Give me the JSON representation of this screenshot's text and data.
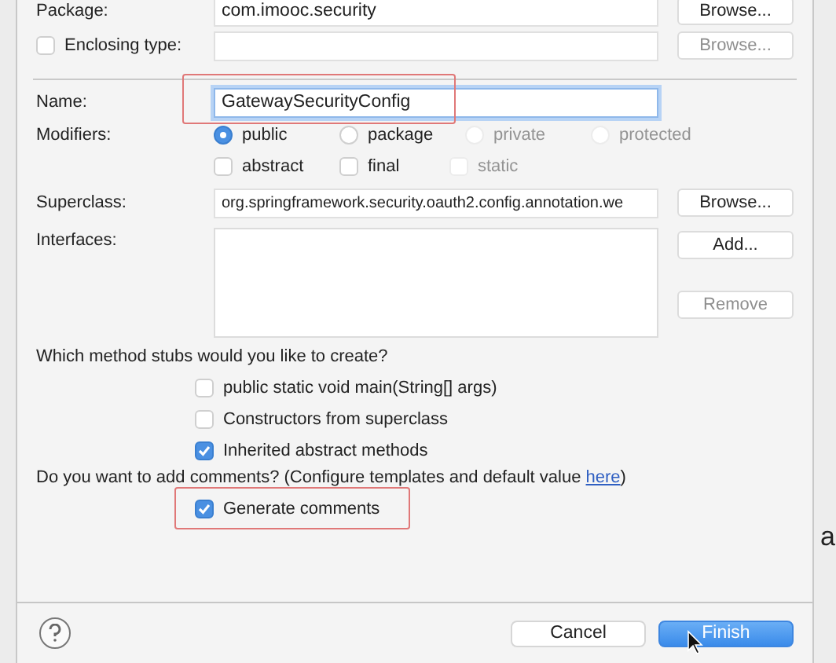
{
  "package": {
    "label": "Package:",
    "value": "com.imooc.security",
    "button": "Browse..."
  },
  "enclosing": {
    "label": "Enclosing type:",
    "checked": false,
    "button": "Browse...",
    "button_disabled": true
  },
  "name": {
    "label": "Name:",
    "value": "GatewaySecurityConfig",
    "highlighted": true
  },
  "modifiers": {
    "label": "Modifiers:",
    "access": [
      {
        "label": "public",
        "selected": true,
        "disabled": false
      },
      {
        "label": "package",
        "selected": false,
        "disabled": false
      },
      {
        "label": "private",
        "selected": false,
        "disabled": true
      },
      {
        "label": "protected",
        "selected": false,
        "disabled": true
      }
    ],
    "flags": [
      {
        "label": "abstract",
        "checked": false,
        "disabled": false
      },
      {
        "label": "final",
        "checked": false,
        "disabled": false
      },
      {
        "label": "static",
        "checked": false,
        "disabled": true
      }
    ]
  },
  "superclass": {
    "label": "Superclass:",
    "value": "org.springframework.security.oauth2.config.annotation.we",
    "button": "Browse..."
  },
  "interfaces": {
    "label": "Interfaces:",
    "buttons": [
      {
        "label": "Add...",
        "disabled": false
      },
      {
        "label": "Remove",
        "disabled": true
      }
    ]
  },
  "stubs": {
    "question": "Which method stubs would you like to create?",
    "options": [
      {
        "label": "public static void main(String[] args)",
        "checked": false
      },
      {
        "label": "Constructors from superclass",
        "checked": false
      },
      {
        "label": "Inherited abstract methods",
        "checked": true
      }
    ]
  },
  "comments": {
    "question": "Do you want to add comments? (Configure templates and default value",
    "link": "here",
    "closing": ")"
  },
  "generate": {
    "label": "Generate comments",
    "checked": true,
    "highlighted": true
  },
  "footer": {
    "buttons": [
      {
        "label": "Cancel",
        "kind": "secondary"
      },
      {
        "label": "Finish",
        "kind": "primary"
      }
    ]
  },
  "right_glyphs": [
    "a"
  ]
}
